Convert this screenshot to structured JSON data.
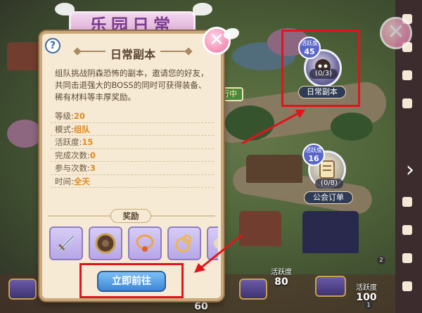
{
  "banner_text": "乐园日常",
  "panel": {
    "help_label": "?",
    "title": "日常副本",
    "description": "组队挑战阴森恐怖的副本，邀请您的好友，共同击退强大的BOSS的同时可获得装备、稀有材料等丰厚奖励。",
    "stats": [
      {
        "label": "等级:",
        "value": "20"
      },
      {
        "label": "模式:",
        "value": "组队"
      },
      {
        "label": "活跃度:",
        "value": "15"
      },
      {
        "label": "完成次数:",
        "value": "0"
      },
      {
        "label": "参与次数:",
        "value": "3"
      },
      {
        "label": "时间:",
        "value": "全天"
      }
    ],
    "reward_title": "奖励",
    "rewards": [
      "sword-icon",
      "shield-icon",
      "necklace-icon",
      "ring-icon",
      "item-icon"
    ],
    "go_button": "立即前往"
  },
  "close_label": "✕",
  "side_tab": "行中",
  "map_nodes": [
    {
      "badge_label": "活跃度",
      "badge_value": "45",
      "count": "(0/3)",
      "label": "日常副本"
    },
    {
      "badge_label": "活跃度",
      "badge_value": "16",
      "count": "(0/8)",
      "label": "公会订单"
    }
  ],
  "bottom": {
    "activity_a_label": "活跃度",
    "activity_a_value": "80",
    "activity_b_label": "活跃度",
    "activity_b_value": "100",
    "partial_value": "60",
    "dot_1": "1",
    "dot_2": "2"
  },
  "colors": {
    "highlight": "#e4131b",
    "stat_value": "#e08a1e",
    "go_button": "#3d86d6"
  }
}
